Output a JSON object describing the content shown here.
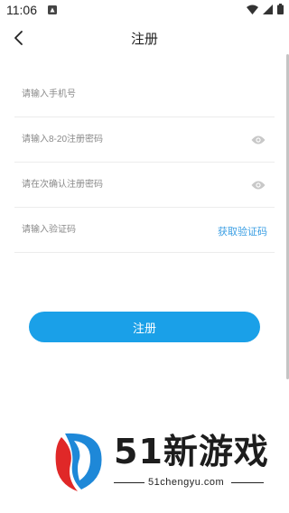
{
  "status_bar": {
    "time": "11:06"
  },
  "header": {
    "title": "注册"
  },
  "form": {
    "phone_placeholder": "请输入手机号",
    "password_placeholder": "请输入8-20注册密码",
    "confirm_placeholder": "请在次确认注册密码",
    "code_placeholder": "请输入验证码",
    "get_code_label": "获取验证码"
  },
  "register_button": {
    "label": "注册"
  },
  "watermark": {
    "brand": "51新游戏",
    "domain": "51chengyu.com"
  },
  "colors": {
    "accent": "#1aa0e8",
    "link": "#3a9ee3"
  }
}
